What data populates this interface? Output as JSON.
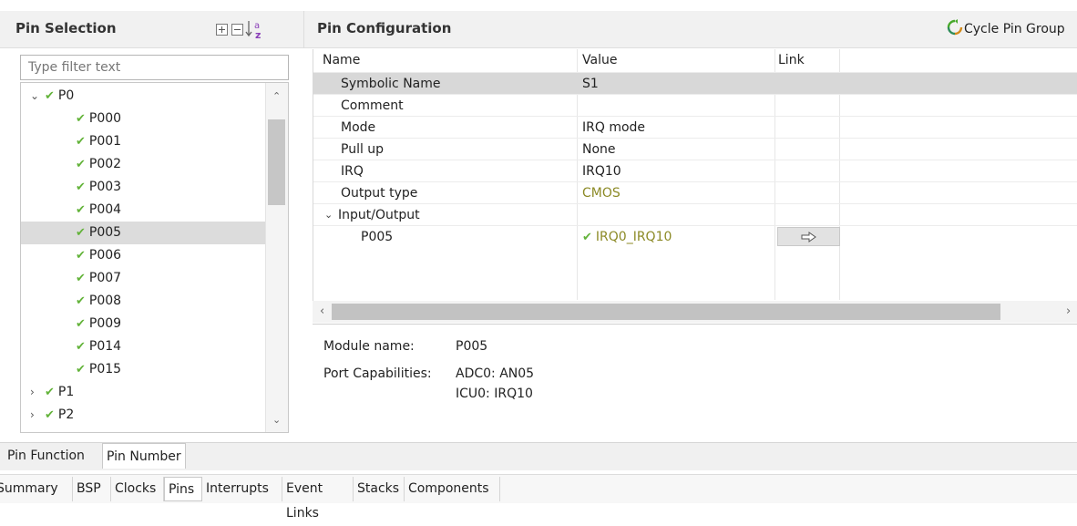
{
  "pin_selection": {
    "title": "Pin Selection",
    "toolbar": {
      "expand_icon": "expand-all-icon",
      "collapse_icon": "collapse-all-icon",
      "sort_icon": "sort-az-icon"
    },
    "filter_placeholder": "Type filter text",
    "tree": [
      {
        "label": "P0",
        "level": 1,
        "expanded": true,
        "checked": true
      },
      {
        "label": "P000",
        "level": 2,
        "checked": true
      },
      {
        "label": "P001",
        "level": 2,
        "checked": true
      },
      {
        "label": "P002",
        "level": 2,
        "checked": true
      },
      {
        "label": "P003",
        "level": 2,
        "checked": true
      },
      {
        "label": "P004",
        "level": 2,
        "checked": true
      },
      {
        "label": "P005",
        "level": 2,
        "checked": true,
        "selected": true
      },
      {
        "label": "P006",
        "level": 2,
        "checked": true
      },
      {
        "label": "P007",
        "level": 2,
        "checked": true
      },
      {
        "label": "P008",
        "level": 2,
        "checked": true
      },
      {
        "label": "P009",
        "level": 2,
        "checked": true
      },
      {
        "label": "P014",
        "level": 2,
        "checked": true
      },
      {
        "label": "P015",
        "level": 2,
        "checked": true
      },
      {
        "label": "P1",
        "level": 1,
        "expanded": false,
        "checked": true
      },
      {
        "label": "P2",
        "level": 1,
        "expanded": false,
        "checked": true
      }
    ]
  },
  "pin_configuration": {
    "title": "Pin Configuration",
    "cycle_button": "Cycle Pin Group",
    "columns": [
      "Name",
      "Value",
      "Link"
    ],
    "rows": [
      {
        "name": "Symbolic Name",
        "value": "S1",
        "selected": true
      },
      {
        "name": "Comment",
        "value": ""
      },
      {
        "name": "Mode",
        "value": "IRQ mode"
      },
      {
        "name": "Pull up",
        "value": "None"
      },
      {
        "name": "IRQ",
        "value": "IRQ10"
      },
      {
        "name": "Output type",
        "value": "CMOS"
      },
      {
        "name": "Input/Output",
        "value": "",
        "group": true
      },
      {
        "name": "P005",
        "value": "IRQ0_IRQ10",
        "link": "arrow-right-icon"
      }
    ],
    "details": {
      "module_label": "Module name:",
      "module_value": "P005",
      "capabilities_label": "Port Capabilities:",
      "capabilities": [
        "ADC0: AN05",
        "ICU0: IRQ10"
      ]
    }
  },
  "sub_tabs": [
    {
      "label": "Pin Function",
      "active": false
    },
    {
      "label": "Pin Number",
      "active": true
    }
  ],
  "main_tabs": [
    {
      "label": "Summary"
    },
    {
      "label": "BSP"
    },
    {
      "label": "Clocks"
    },
    {
      "label": "Pins",
      "active": true
    },
    {
      "label": "Interrupts"
    },
    {
      "label": "Event Links"
    },
    {
      "label": "Stacks"
    },
    {
      "label": "Components"
    }
  ],
  "colors": {
    "check": "#63b33a",
    "olive_value": "#8c8a26",
    "selection": "#dcdcdc"
  }
}
